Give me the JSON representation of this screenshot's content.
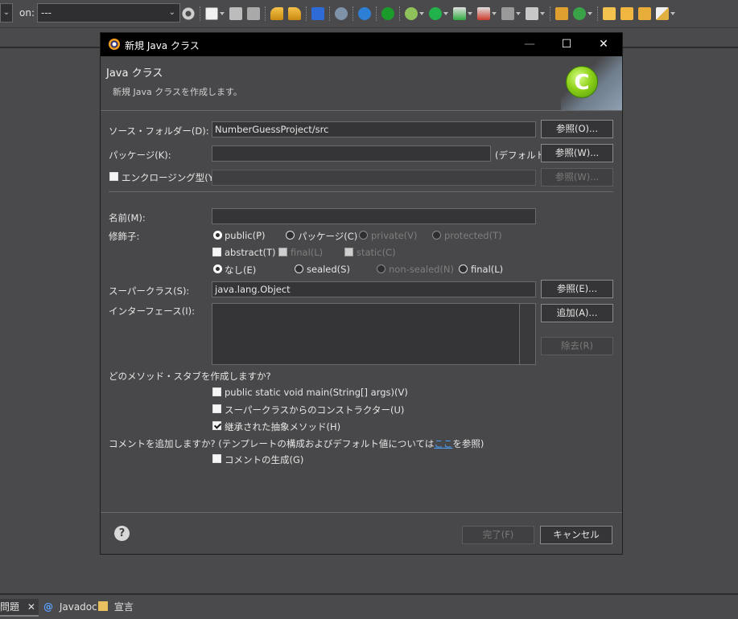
{
  "toolbar": {
    "on_label": "on:",
    "combo_value": "---",
    "icons": [
      "gear-icon",
      "new-wizard-icon",
      "save-icon",
      "save-all-icon",
      "undo-icon",
      "redo-icon",
      "console-icon",
      "skip-icon",
      "debug-settings-icon",
      "power-icon",
      "bug-icon",
      "run-icon",
      "run-last-icon",
      "coverage-icon",
      "stop-icon",
      "tools-icon",
      "new-package-icon",
      "refresh-icon",
      "open-folder-icon",
      "open-file-icon",
      "open-file2-icon",
      "brush-icon"
    ]
  },
  "bottom_tabs": [
    {
      "label": "問題",
      "icon": "close-icon"
    },
    {
      "label": "Javadoc",
      "icon": "at-icon"
    },
    {
      "label": "宣言",
      "icon": "declaration-icon"
    }
  ],
  "dialog": {
    "title": "新規 Java クラス",
    "window_buttons": {
      "minimize": "—",
      "maximize": "☐",
      "close": "✕"
    },
    "banner": {
      "heading": "Java クラス",
      "description": "新規 Java クラスを作成します。",
      "icon_letter": "C"
    },
    "source_folder": {
      "label": "ソース・フォルダー(D):",
      "value": "NumberGuessProject/src",
      "browse_label": "参照(O)..."
    },
    "package": {
      "label": "パッケージ(K):",
      "value": "",
      "default_text": "(デフォルト)",
      "browse_label": "参照(W)..."
    },
    "enclosing": {
      "label": "エンクロージング型(Y):",
      "value": "",
      "browse_label": "参照(W)..."
    },
    "name": {
      "label": "名前(M):",
      "value": ""
    },
    "modifiers": {
      "label": "修飾子:",
      "access": [
        {
          "label": "public(P)",
          "selected": true,
          "enabled": true
        },
        {
          "label": "パッケージ(C)",
          "selected": false,
          "enabled": true
        },
        {
          "label": "private(V)",
          "selected": false,
          "enabled": false
        },
        {
          "label": "protected(T)",
          "selected": false,
          "enabled": false
        }
      ],
      "flags": [
        {
          "label": "abstract(T)",
          "checked": false,
          "enabled": true
        },
        {
          "label": "final(L)",
          "checked": false,
          "enabled": false
        },
        {
          "label": "static(C)",
          "checked": false,
          "enabled": false
        }
      ],
      "sealing": [
        {
          "label": "なし(E)",
          "selected": true,
          "enabled": true
        },
        {
          "label": "sealed(S)",
          "selected": false,
          "enabled": true
        },
        {
          "label": "non-sealed(N)",
          "selected": false,
          "enabled": false
        },
        {
          "label": "final(L)",
          "selected": false,
          "enabled": true
        }
      ]
    },
    "superclass": {
      "label": "スーパークラス(S):",
      "value": "java.lang.Object",
      "browse_label": "参照(E)..."
    },
    "interfaces": {
      "label": "インターフェース(I):",
      "add_label": "追加(A)...",
      "remove_label": "除去(R)"
    },
    "stubs": {
      "question": "どのメソッド・スタブを作成しますか?",
      "items": [
        {
          "label": "public static void main(String[] args)(V)",
          "checked": false
        },
        {
          "label": "スーパークラスからのコンストラクター(U)",
          "checked": false
        },
        {
          "label": "継承された抽象メソッド(H)",
          "checked": true
        }
      ]
    },
    "comments": {
      "question_prefix": "コメントを追加しますか? (テンプレートの構成およびデフォルト値については",
      "link": "ここ",
      "question_suffix": "を参照)",
      "generate_label": "コメントの生成(G)",
      "checked": false
    },
    "footer": {
      "finish_label": "完了(F)",
      "cancel_label": "キャンセル",
      "help": "?"
    }
  }
}
